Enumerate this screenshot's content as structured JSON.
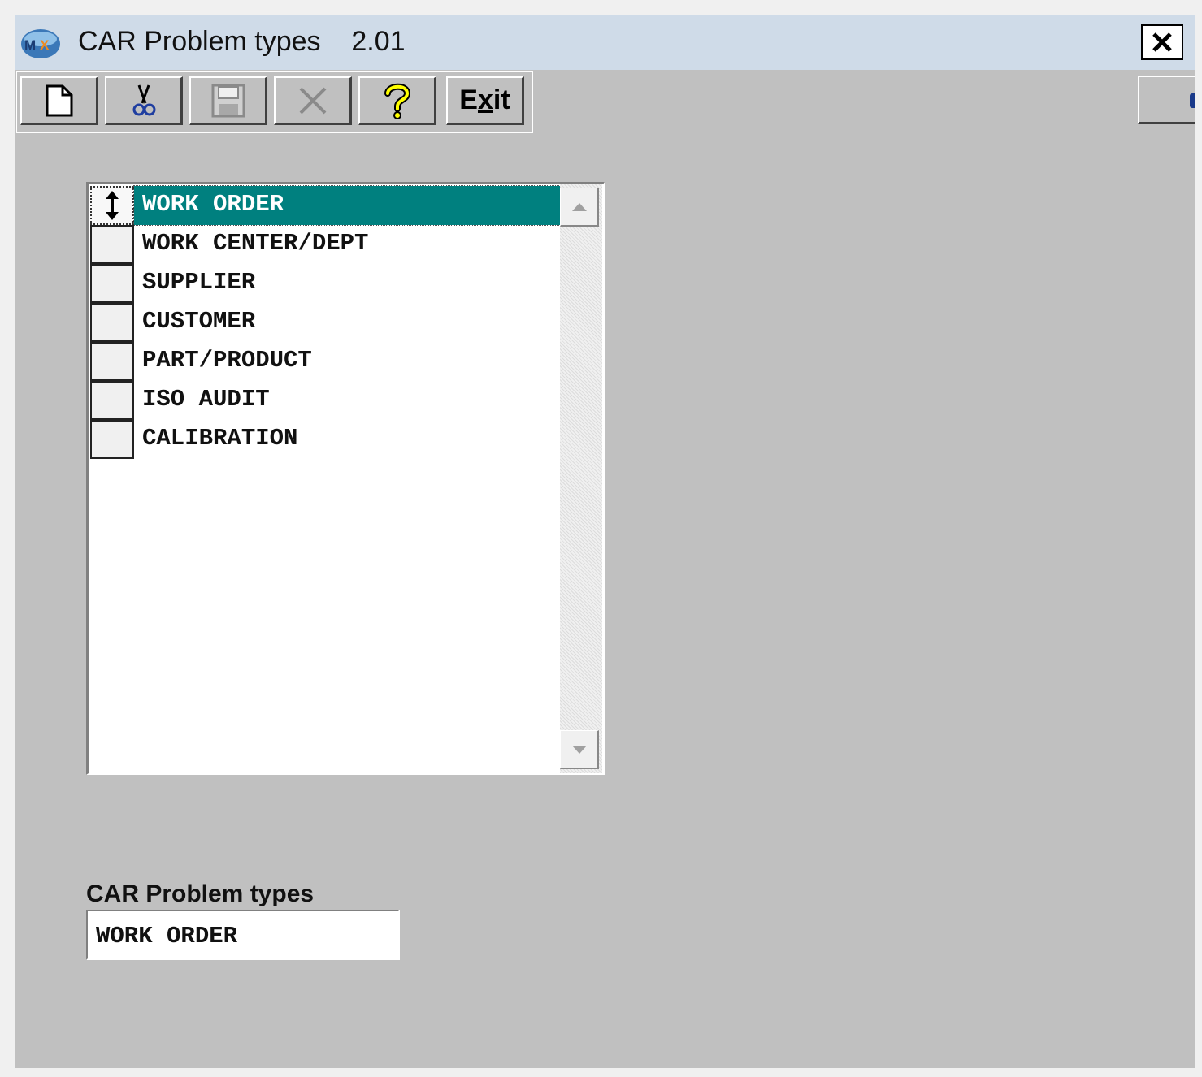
{
  "window": {
    "title": "CAR Problem types",
    "version": "2.01",
    "close_icon": "close-x-icon"
  },
  "toolbar": {
    "buttons": [
      {
        "name": "new",
        "icon": "new-document-icon"
      },
      {
        "name": "cut",
        "icon": "scissors-icon"
      },
      {
        "name": "save",
        "icon": "floppy-disk-icon",
        "disabled": true
      },
      {
        "name": "delete",
        "icon": "x-delete-icon",
        "disabled": true
      },
      {
        "name": "help",
        "icon": "question-mark-icon"
      }
    ],
    "exit_label_pre": "E",
    "exit_label_ul": "x",
    "exit_label_post": "it"
  },
  "list": {
    "selected_index": 0,
    "items": [
      "WORK ORDER",
      "WORK CENTER/DEPT",
      "SUPPLIER",
      "CUSTOMER",
      "PART/PRODUCT",
      "ISO AUDIT",
      "CALIBRATION"
    ]
  },
  "field": {
    "label": "CAR Problem types",
    "value": "WORK ORDER"
  },
  "colors": {
    "selection": "#00807f",
    "window_bg": "#c0c0c0",
    "titlebar": "#cfdbe8",
    "help_icon": "#ffff00"
  }
}
